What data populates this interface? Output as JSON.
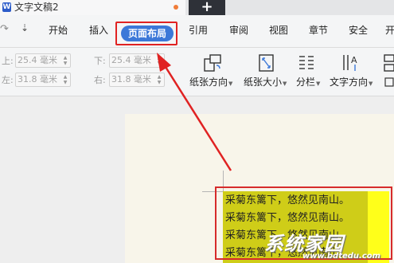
{
  "window": {
    "doc_tab_title": "文字文稿2",
    "new_tab_symbol": "+"
  },
  "menu": {
    "redo_symbol": "↷",
    "more_symbol": "⇣",
    "items": [
      "开始",
      "插入",
      "页面布局",
      "引用",
      "审阅",
      "视图",
      "章节",
      "安全",
      "开"
    ],
    "active": "页面布局"
  },
  "ribbon": {
    "margins": {
      "top_label": "上:",
      "top_value": "25.4 毫米",
      "bottom_label": "下:",
      "bottom_value": "25.4 毫米",
      "left_label": "左:",
      "left_value": "31.8 毫米",
      "right_label": "右:",
      "right_value": "31.8 毫米"
    },
    "buttons": [
      {
        "label": "纸张方向",
        "icon": "page-orientation-icon"
      },
      {
        "label": "纸张大小",
        "icon": "paper-size-icon"
      },
      {
        "label": "分栏",
        "icon": "columns-icon"
      },
      {
        "label": "文字方向",
        "icon": "text-direction-icon"
      }
    ]
  },
  "document": {
    "lines": [
      "采菊东篱下，悠然见南山。",
      "采菊东篱下，悠然见南山。",
      "采菊东篱下，悠然见南山。",
      "采菊东篱下，悠然见南山。"
    ]
  },
  "watermark": {
    "logo_text": "系统家园",
    "url": "www.bdtedu.com"
  },
  "colors": {
    "accent": "#3c78d8",
    "annotation_red": "#e02222",
    "highlight_olive": "#cfcd18",
    "highlight_yellow": "#ffff1a"
  }
}
